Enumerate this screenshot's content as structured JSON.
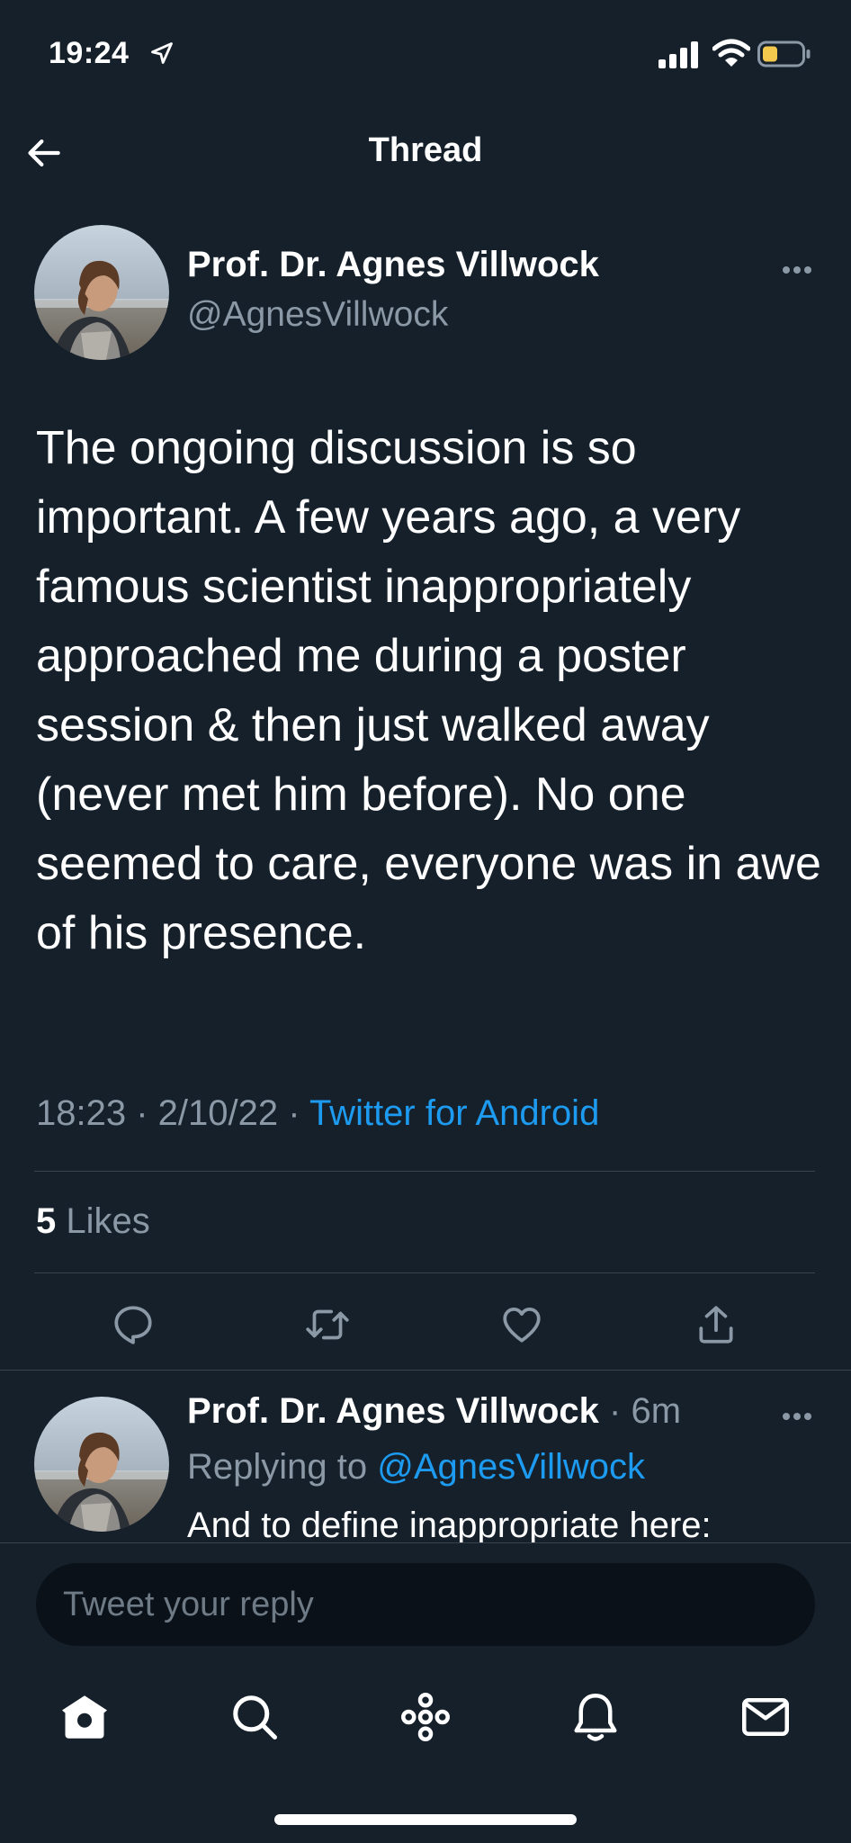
{
  "status_bar": {
    "time": "19:24",
    "battery_color": "#f2c94c"
  },
  "header": {
    "title": "Thread"
  },
  "tweet": {
    "author_name": "Prof. Dr. Agnes Villwock",
    "author_handle": "@AgnesVillwock",
    "text": "The ongoing discussion is so important. A few years ago, a very famous scientist inappropriately approached me during a poster session & then just walked away (never met him before). No one seemed to care, everyone was in awe of his presence.",
    "time": "18:23",
    "date": "2/10/22",
    "separator": " · ",
    "source": "Twitter for Android",
    "likes_count": "5",
    "likes_label": " Likes"
  },
  "reply": {
    "author_name": "Prof. Dr. Agnes Villwock",
    "time_ago": "6m",
    "separator": " · ",
    "replying_label": "Replying to ",
    "replying_to": "@AgnesVillwock",
    "text": "And to define inappropriate here:"
  },
  "composer": {
    "placeholder": "Tweet your reply"
  },
  "colors": {
    "background": "#15202b",
    "accent": "#1d9bf0",
    "secondary_text": "#8b98a5",
    "divider": "#38444d"
  },
  "tabs": [
    {
      "icon": "home-icon"
    },
    {
      "icon": "search-icon"
    },
    {
      "icon": "spaces-icon"
    },
    {
      "icon": "bell-icon"
    },
    {
      "icon": "mail-icon"
    }
  ]
}
